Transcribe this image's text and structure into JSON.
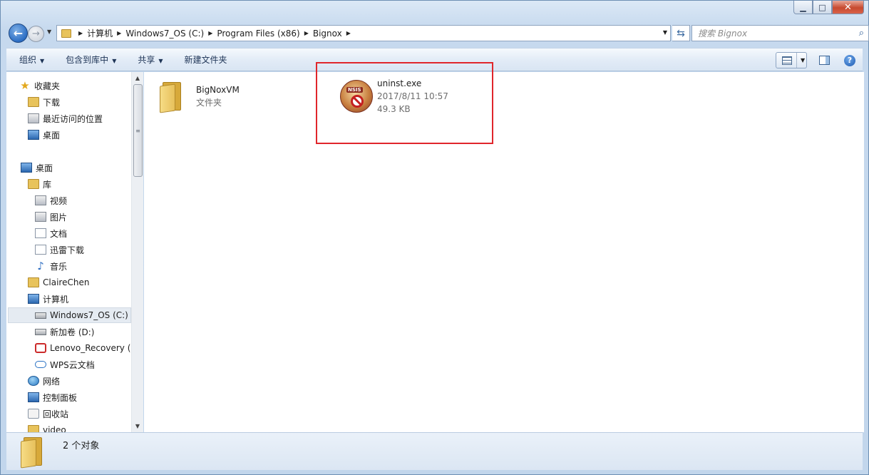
{
  "window": {
    "caption_buttons": [
      "minimize-icon",
      "maximize-icon",
      "close-icon"
    ]
  },
  "address": {
    "breadcrumbs": [
      "计算机",
      "Windows7_OS (C:)",
      "Program Files (x86)",
      "Bignox"
    ]
  },
  "search": {
    "placeholder": "搜索 Bignox"
  },
  "toolbar": {
    "organize": "组织",
    "include_library": "包含到库中",
    "share": "共享",
    "new_folder": "新建文件夹"
  },
  "navpane": {
    "favorites": "收藏夹",
    "downloads": "下载",
    "recent": "最近访问的位置",
    "desktop_fav": "桌面",
    "desktop": "桌面",
    "libraries": "库",
    "videos": "视频",
    "pictures": "图片",
    "documents": "文档",
    "xunlei": "迅雷下载",
    "music": "音乐",
    "user": "ClaireChen",
    "computer": "计算机",
    "drive_c": "Windows7_OS (C:)",
    "drive_d": "新加卷 (D:)",
    "recovery": "Lenovo_Recovery (C",
    "wps": "WPS云文档",
    "network": "网络",
    "control_panel": "控制面板",
    "recycle_bin": "回收站",
    "video": "video"
  },
  "files": [
    {
      "name": "BigNoxVM",
      "type": "文件夹"
    },
    {
      "name": "uninst.exe",
      "date": "2017/8/11 10:57",
      "size": "49.3 KB"
    }
  ],
  "status": {
    "count": "2 个对象"
  },
  "colors": {
    "highlight_box": "#e0262b",
    "window_chrome": "#c6d9ee"
  }
}
